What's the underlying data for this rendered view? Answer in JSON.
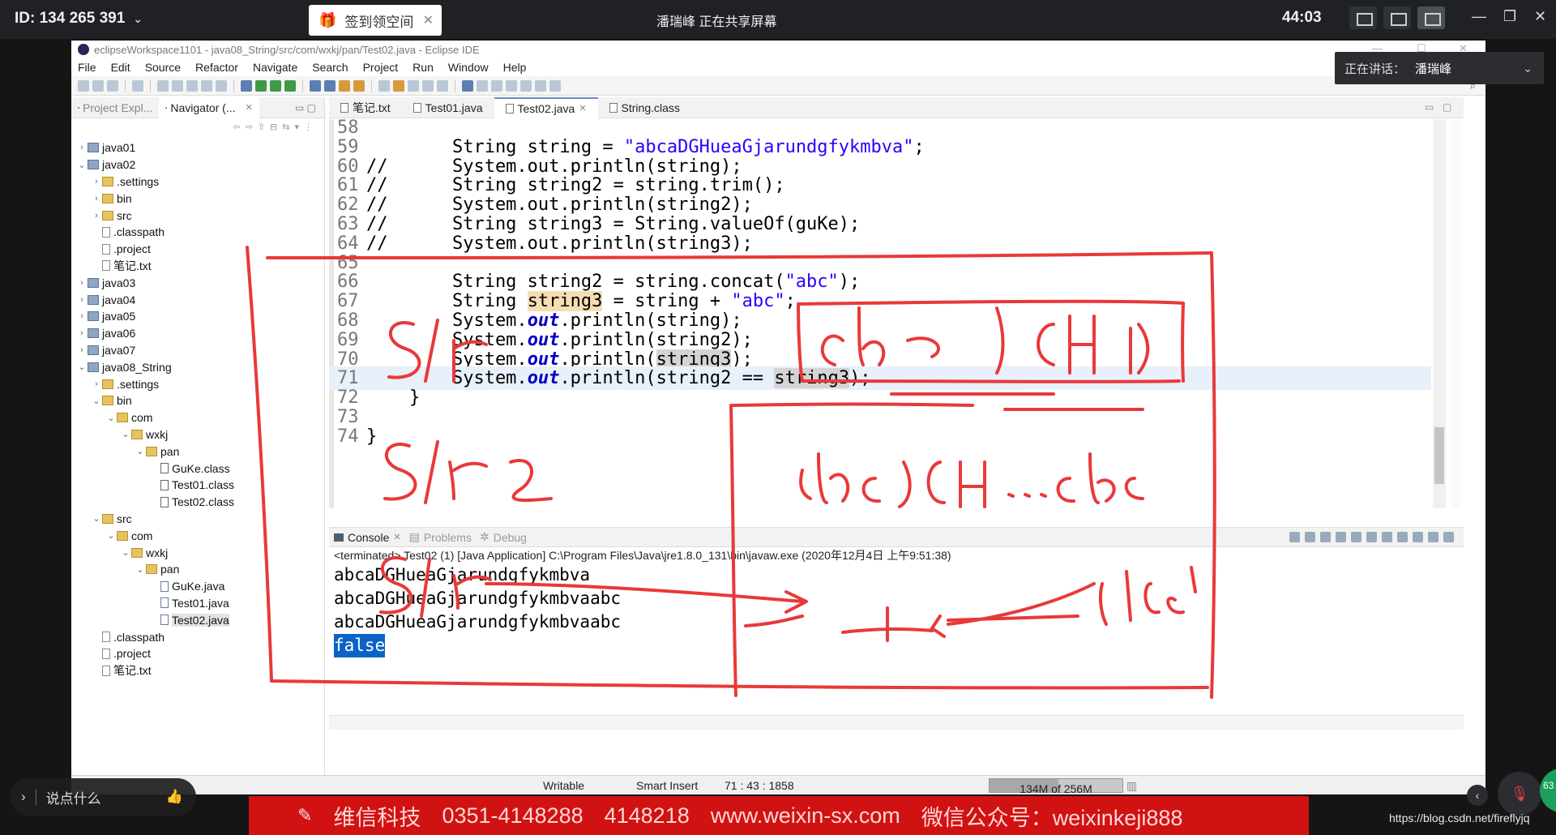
{
  "meeting": {
    "id_text": "ID: 134 265 391",
    "signin_label": "签到领空间",
    "share_status": "潘瑞峰 正在共享屏幕",
    "timer": "44:03",
    "speaking_label": "正在讲话：",
    "speaking_name": "潘瑞峰",
    "chat_placeholder": "说点什么",
    "badge_count": "63"
  },
  "eclipse": {
    "window_title": "eclipseWorkspace1101 - java08_String/src/com/wxkj/pan/Test02.java - Eclipse IDE",
    "menu": [
      "File",
      "Edit",
      "Source",
      "Refactor",
      "Navigate",
      "Search",
      "Project",
      "Run",
      "Window",
      "Help"
    ],
    "left_tabs": [
      "Project Expl...",
      "Navigator (..."
    ],
    "tree": [
      {
        "label": "java01",
        "depth": 0,
        "arrow": "›",
        "icon": "proj"
      },
      {
        "label": "java02",
        "depth": 0,
        "arrow": "⌄",
        "icon": "proj"
      },
      {
        "label": ".settings",
        "depth": 1,
        "arrow": "›",
        "icon": "folder"
      },
      {
        "label": "bin",
        "depth": 1,
        "arrow": "›",
        "icon": "folder"
      },
      {
        "label": "src",
        "depth": 1,
        "arrow": "›",
        "icon": "folder"
      },
      {
        "label": ".classpath",
        "depth": 1,
        "arrow": "",
        "icon": "file"
      },
      {
        "label": ".project",
        "depth": 1,
        "arrow": "",
        "icon": "file"
      },
      {
        "label": "笔记.txt",
        "depth": 1,
        "arrow": "",
        "icon": "file"
      },
      {
        "label": "java03",
        "depth": 0,
        "arrow": "›",
        "icon": "proj"
      },
      {
        "label": "java04",
        "depth": 0,
        "arrow": "›",
        "icon": "proj"
      },
      {
        "label": "java05",
        "depth": 0,
        "arrow": "›",
        "icon": "proj"
      },
      {
        "label": "java06",
        "depth": 0,
        "arrow": "›",
        "icon": "proj"
      },
      {
        "label": "java07",
        "depth": 0,
        "arrow": "›",
        "icon": "proj"
      },
      {
        "label": "java08_String",
        "depth": 0,
        "arrow": "⌄",
        "icon": "proj"
      },
      {
        "label": ".settings",
        "depth": 1,
        "arrow": "›",
        "icon": "folder"
      },
      {
        "label": "bin",
        "depth": 1,
        "arrow": "⌄",
        "icon": "folder"
      },
      {
        "label": "com",
        "depth": 2,
        "arrow": "⌄",
        "icon": "folder"
      },
      {
        "label": "wxkj",
        "depth": 3,
        "arrow": "⌄",
        "icon": "folder"
      },
      {
        "label": "pan",
        "depth": 4,
        "arrow": "⌄",
        "icon": "folder"
      },
      {
        "label": "GuKe.class",
        "depth": 5,
        "arrow": "",
        "icon": "cls"
      },
      {
        "label": "Test01.class",
        "depth": 5,
        "arrow": "",
        "icon": "cls"
      },
      {
        "label": "Test02.class",
        "depth": 5,
        "arrow": "",
        "icon": "cls"
      },
      {
        "label": "src",
        "depth": 1,
        "arrow": "⌄",
        "icon": "folder"
      },
      {
        "label": "com",
        "depth": 2,
        "arrow": "⌄",
        "icon": "folder"
      },
      {
        "label": "wxkj",
        "depth": 3,
        "arrow": "⌄",
        "icon": "folder"
      },
      {
        "label": "pan",
        "depth": 4,
        "arrow": "⌄",
        "icon": "folder"
      },
      {
        "label": "GuKe.java",
        "depth": 5,
        "arrow": "",
        "icon": "java"
      },
      {
        "label": "Test01.java",
        "depth": 5,
        "arrow": "",
        "icon": "java"
      },
      {
        "label": "Test02.java",
        "depth": 5,
        "arrow": "",
        "icon": "java",
        "selected": true
      },
      {
        "label": ".classpath",
        "depth": 1,
        "arrow": "",
        "icon": "file"
      },
      {
        "label": ".project",
        "depth": 1,
        "arrow": "",
        "icon": "file"
      },
      {
        "label": "笔记.txt",
        "depth": 1,
        "arrow": "",
        "icon": "file"
      }
    ],
    "editor_tabs": [
      {
        "label": "笔记.txt",
        "active": false,
        "close": false
      },
      {
        "label": "Test01.java",
        "active": false,
        "close": false
      },
      {
        "label": "Test02.java",
        "active": true,
        "close": true
      },
      {
        "label": "String.class",
        "active": false,
        "close": false
      }
    ],
    "code_lines": [
      {
        "n": "58",
        "html": ""
      },
      {
        "n": "59",
        "html": "        String string = <span class=\"str\">\"abcaDGHueaGjarundgfykmbva\"</span>;"
      },
      {
        "n": "60",
        "html": "//      System.out.println(string);"
      },
      {
        "n": "61",
        "html": "//      String string2 = string.trim();"
      },
      {
        "n": "62",
        "html": "//      System.out.println(string2);"
      },
      {
        "n": "63",
        "html": "//      String string3 = String.valueOf(guKe);"
      },
      {
        "n": "64",
        "html": "//      System.out.println(string3);"
      },
      {
        "n": "65",
        "html": ""
      },
      {
        "n": "66",
        "html": "        String string2 = string.concat(<span class=\"str\">\"abc\"</span>);"
      },
      {
        "n": "67",
        "html": "        String <span class=\"hl\">string3</span> = string + <span class=\"str\">\"abc\"</span>;"
      },
      {
        "n": "68",
        "html": "        System.<span class=\"fld\">out</span>.println(string);"
      },
      {
        "n": "69",
        "html": "        System.<span class=\"fld\">out</span>.println(string2);"
      },
      {
        "n": "70",
        "html": "        System.<span class=\"fld\">out</span>.println(<span class=\"hl2\">string3</span>);"
      },
      {
        "n": "71",
        "html": "        System.<span class=\"fld\">out</span>.println(string2 == <span class=\"hl2\">string3</span>);",
        "current": true
      },
      {
        "n": "72",
        "html": "    }"
      },
      {
        "n": "73",
        "html": ""
      },
      {
        "n": "74",
        "html": "}"
      }
    ],
    "console": {
      "tabs": [
        "Console",
        "Problems",
        "Debug"
      ],
      "terminated": "<terminated> Test02 (1) [Java Application] C:\\Program Files\\Java\\jre1.8.0_131\\bin\\javaw.exe (2020年12月4日 上午9:51:38)",
      "output": [
        "abcaDGHueaGjarundgfykmbva",
        "abcaDGHueaGjarundgfykmbvaabc",
        "abcaDGHueaGjarundgfykmbvaabc"
      ],
      "selected_output": "false"
    },
    "status": {
      "writable": "Writable",
      "insert": "Smart Insert",
      "position": "71 : 43 : 1858",
      "heap": "134M of 256M",
      "heap_used_fraction": 0.52
    }
  },
  "banner": {
    "items": [
      "维信科技",
      "0351-4148288",
      "4148218",
      "www.weixin-sx.com",
      "微信公众号：weixinkeji888"
    ]
  },
  "watermark": "https://blog.csdn.net/fireflyjq",
  "ink_color": "#e8393a"
}
